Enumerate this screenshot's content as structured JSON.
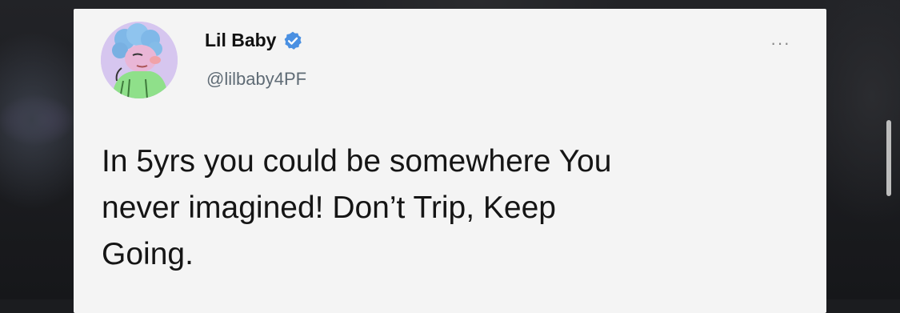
{
  "tweet": {
    "display_name": "Lil Baby",
    "handle": "@lilbaby4PF",
    "more_label": "···",
    "text": "In 5yrs you could be somewhere You\nnever imagined!  Don’t Trip, Keep\nGoing."
  },
  "icons": {
    "verified": "verified-badge-icon",
    "more": "more-options-icon",
    "avatar": "cartoon-avatar"
  },
  "colors": {
    "verified_blue": "#4a90e2",
    "card_bg": "#f4f4f4",
    "handle_gray": "#5f6b75"
  }
}
